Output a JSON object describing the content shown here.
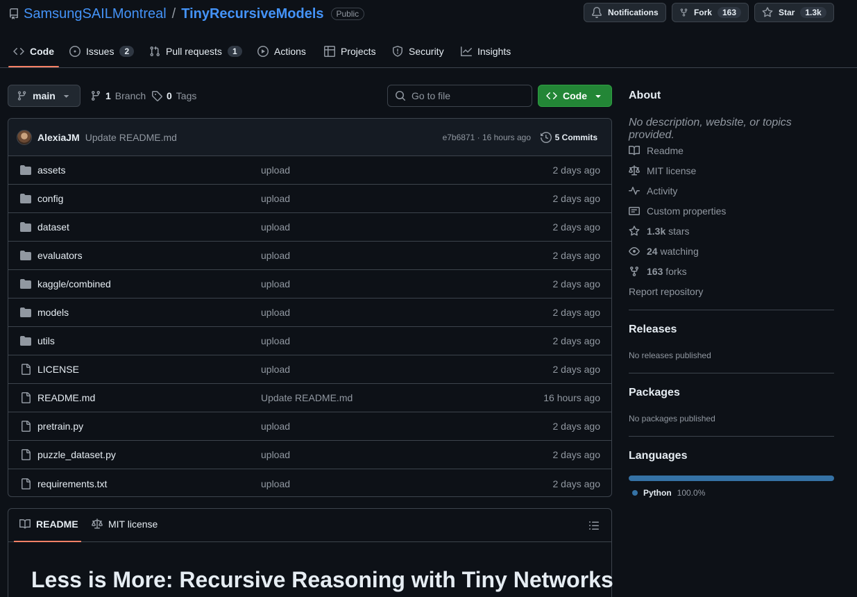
{
  "repo": {
    "owner": "SamsungSAILMontreal",
    "separator": "/",
    "name": "TinyRecursiveModels",
    "visibility": "Public"
  },
  "header_actions": {
    "notifications": "Notifications",
    "fork_label": "Fork",
    "fork_count": "163",
    "star_label": "Star",
    "star_count": "1.3k"
  },
  "nav": {
    "code": "Code",
    "issues": "Issues",
    "issues_count": "2",
    "pulls": "Pull requests",
    "pulls_count": "1",
    "actions": "Actions",
    "projects": "Projects",
    "security": "Security",
    "insights": "Insights"
  },
  "toolbar": {
    "branch": "main",
    "branches_count": "1",
    "branches_label": "Branch",
    "tags_count": "0",
    "tags_label": "Tags",
    "search_placeholder": "Go to file",
    "code_button": "Code"
  },
  "latest_commit": {
    "author": "AlexiaJM",
    "message": "Update README.md",
    "meta": "e7b6871 · 16 hours ago",
    "commits": "5 Commits"
  },
  "files": [
    {
      "type": "folder",
      "name": "assets",
      "message": "upload",
      "date": "2 days ago"
    },
    {
      "type": "folder",
      "name": "config",
      "message": "upload",
      "date": "2 days ago"
    },
    {
      "type": "folder",
      "name": "dataset",
      "message": "upload",
      "date": "2 days ago"
    },
    {
      "type": "folder",
      "name": "evaluators",
      "message": "upload",
      "date": "2 days ago"
    },
    {
      "type": "folder",
      "name": "kaggle/combined",
      "message": "upload",
      "date": "2 days ago"
    },
    {
      "type": "folder",
      "name": "models",
      "message": "upload",
      "date": "2 days ago"
    },
    {
      "type": "folder",
      "name": "utils",
      "message": "upload",
      "date": "2 days ago"
    },
    {
      "type": "file",
      "name": "LICENSE",
      "message": "upload",
      "date": "2 days ago"
    },
    {
      "type": "file",
      "name": "README.md",
      "message": "Update README.md",
      "date": "16 hours ago"
    },
    {
      "type": "file",
      "name": "pretrain.py",
      "message": "upload",
      "date": "2 days ago"
    },
    {
      "type": "file",
      "name": "puzzle_dataset.py",
      "message": "upload",
      "date": "2 days ago"
    },
    {
      "type": "file",
      "name": "requirements.txt",
      "message": "upload",
      "date": "2 days ago"
    }
  ],
  "readme": {
    "tab_readme": "README",
    "tab_license": "MIT license",
    "heading": "Less is More: Recursive Reasoning with Tiny Networks"
  },
  "about": {
    "title": "About",
    "description": "No description, website, or topics provided.",
    "readme": "Readme",
    "license": "MIT license",
    "activity": "Activity",
    "custom_properties": "Custom properties",
    "stars_count": "1.3k",
    "stars_label": "stars",
    "watching_count": "24",
    "watching_label": "watching",
    "forks_count": "163",
    "forks_label": "forks",
    "report": "Report repository"
  },
  "releases": {
    "title": "Releases",
    "text": "No releases published"
  },
  "packages": {
    "title": "Packages",
    "text": "No packages published"
  },
  "languages": {
    "title": "Languages",
    "name": "Python",
    "percent": "100.0%",
    "color": "#3572a5"
  }
}
